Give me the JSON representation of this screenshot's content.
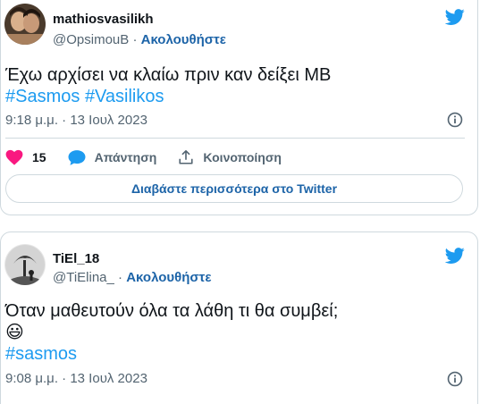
{
  "tweets": [
    {
      "display_name": "mathiosvasilikh",
      "handle": "@OpsimouB",
      "separator": "·",
      "follow_label": "Ακολουθήστε",
      "text": "Έχω αρχίσει να κλαίω πριν καν δείξει MB",
      "hashtags": [
        "#Sasmos",
        "#Vasilikos"
      ],
      "time": "9:18 μ.μ.",
      "date": "13 Ιουλ 2023",
      "like_count": "15",
      "reply_label": "Απάντηση",
      "share_label": "Κοινοποίηση",
      "read_more_label": "Διαβάστε περισσότερα στο Twitter",
      "icons": {
        "like": "heart-icon",
        "reply": "speech-bubble-icon",
        "share": "share-icon",
        "info": "info-icon",
        "brand": "twitter-bird-icon"
      }
    },
    {
      "display_name": "TiEl_18",
      "handle": "@TiElina_",
      "separator": "·",
      "follow_label": "Ακολουθήστε",
      "text": "Όταν μαθευτούν όλα τα λάθη τι θα συμβεί;",
      "emoji": "😃",
      "hashtags": [
        "#sasmos"
      ],
      "time": "9:08 μ.μ.",
      "date": "13 Ιουλ 2023",
      "icons": {
        "info": "info-icon",
        "brand": "twitter-bird-icon"
      }
    }
  ],
  "colors": {
    "accent": "#1d9bf0",
    "follow": "#1d64a8",
    "like": "#f91880",
    "muted": "#536471",
    "border": "#cfd9de"
  }
}
